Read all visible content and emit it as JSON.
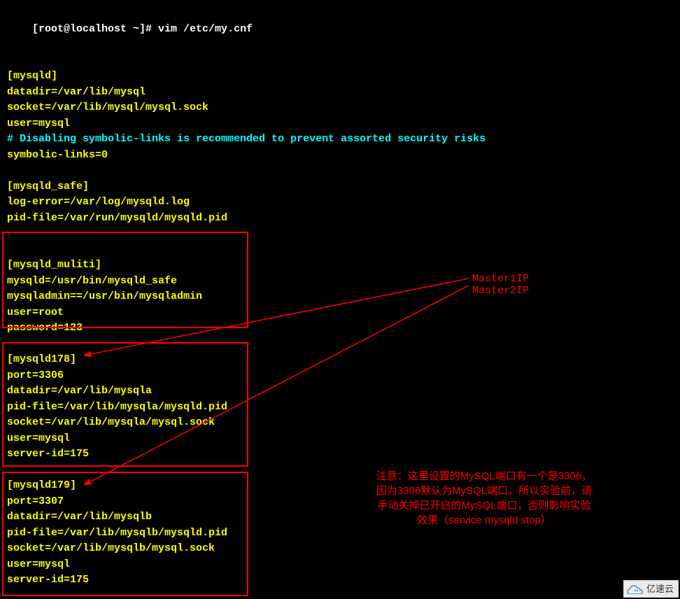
{
  "prompt": {
    "userhost": "[root@localhost ~]# ",
    "cmd": "vim /etc/my.cnf"
  },
  "config": {
    "section_mysqld": "[mysqld]",
    "datadir": "datadir=/var/lib/mysql",
    "socket": "socket=/var/lib/mysql/mysql.sock",
    "user": "user=mysql",
    "comment": "# Disabling symbolic-links is recommended to prevent assorted security risks",
    "symlinks": "symbolic-links=0",
    "section_safe": "[mysqld_safe]",
    "logerror": "log-error=/var/log/mysqld.log",
    "pidfile": "pid-file=/var/run/mysqld/mysqld.pid"
  },
  "block1": {
    "section": "[mysqld_muliti]",
    "mysqld": "mysqld=/usr/bin/mysqld_safe",
    "mysqladmin": "mysqladmin==/usr/bin/mysqladmin",
    "user": "user=root",
    "password": "password=123"
  },
  "block2": {
    "section": "[mysqld178]",
    "port": "port=3306",
    "datadir": "datadir=/var/lib/mysqla",
    "pidfile": "pid-file=/var/lib/mysqla/mysqld.pid",
    "socket": "socket=/var/lib/mysqla/mysql.sock",
    "user": "user=mysql",
    "serverid": "server-id=175"
  },
  "block3": {
    "section": "[mysqld179]",
    "port": "port=3307",
    "datadir": "datadir=/var/lib/mysqlb",
    "pidfile": "pid-file=/var/lib/mysqlb/mysqld.pid",
    "socket": "socket=/var/lib/mysqlb/mysql.sock",
    "user": "user=mysql",
    "serverid": "server-id=175"
  },
  "annotations": {
    "master1": "Master1IP",
    "master2": "Master2IP",
    "note_l1": "注意：这里设置的MySQL端口有一个是3306，",
    "note_l2": "因为3306默认为MySQL端口，所以实验前，请",
    "note_l3": "手动关掉已开启的MySQL端口，否则影响实验",
    "note_l4": "效果（service mysqld stop）"
  },
  "watermark": {
    "text": "亿速云"
  }
}
